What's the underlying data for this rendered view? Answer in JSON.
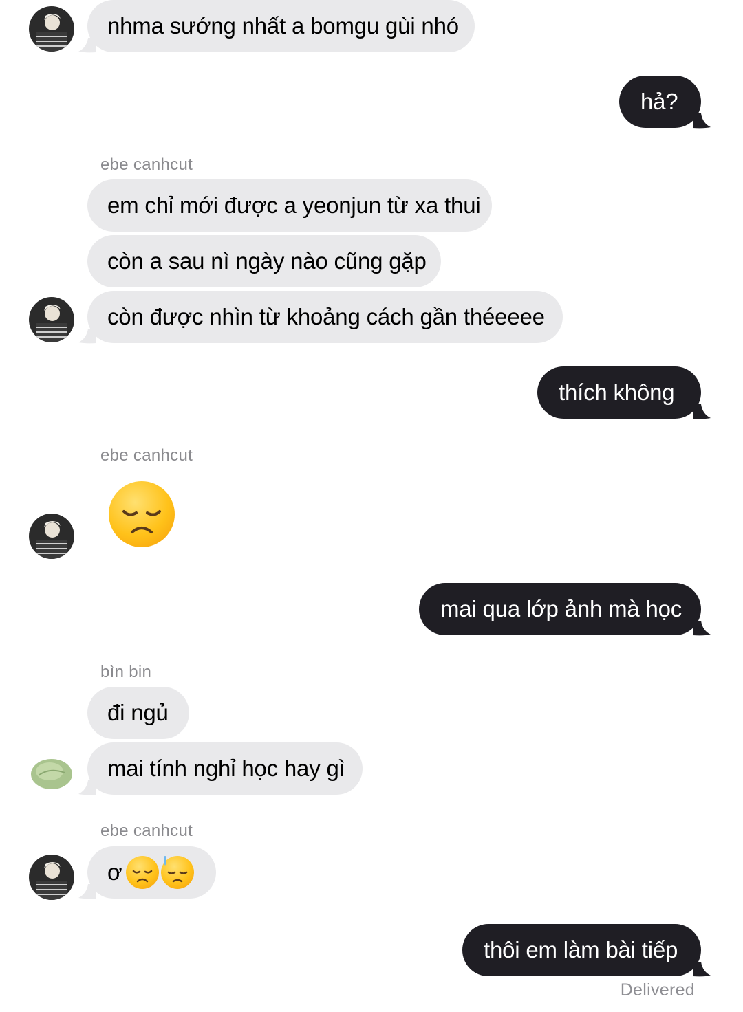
{
  "conversation": {
    "senders": {
      "first": "ebe canhcut",
      "second": "ebe canhcut",
      "third": "bìn bin",
      "fourth": "ebe canhcut"
    },
    "messages": {
      "m1": "nhma sướng nhất a bomgu gùi nhó",
      "m2": "hả?",
      "m3": "em chỉ mới được a yeonjun từ xa thui",
      "m4": "còn a sau nì ngày nào cũng gặp",
      "m5": "còn được nhìn từ khoảng cách gần théeeee",
      "m6": "thích không",
      "m8": "mai qua lớp ảnh mà học",
      "m9": "đi ngủ",
      "m10": "mai tính nghỉ học hay gì",
      "m11": "ơ",
      "m12": "thôi em làm bài tiếp"
    },
    "emoji": {
      "m7": "disappointed-face",
      "m11a": "disappointed-face",
      "m11b": "downcast-face-with-sweat"
    },
    "status": "Delivered"
  },
  "colors": {
    "incoming_bubble": "#e9e9eb",
    "outgoing_bubble": "#1f1e24",
    "sender_label": "#8a8a8e"
  }
}
